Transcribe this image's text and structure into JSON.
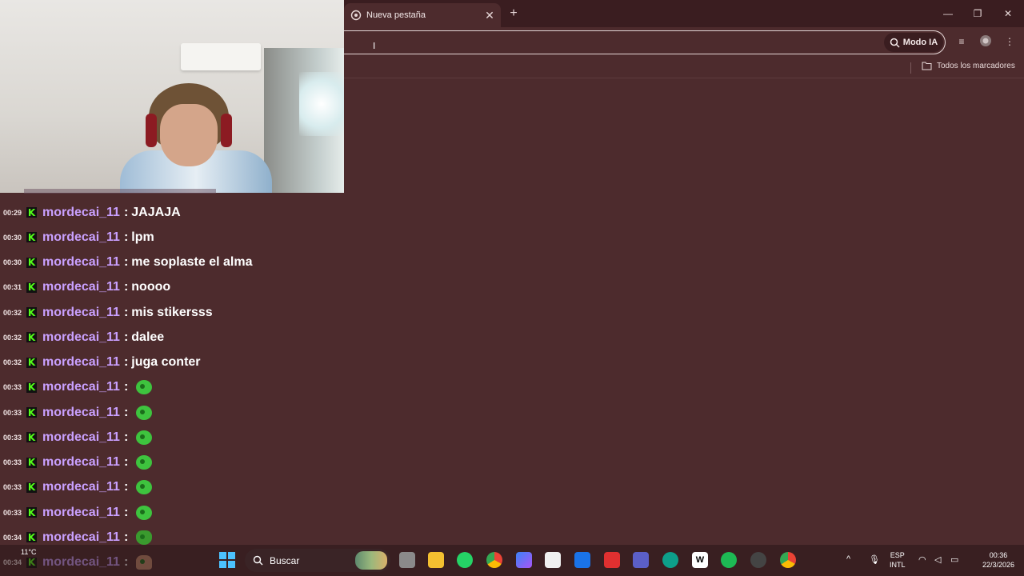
{
  "browser": {
    "tab_title": "Nueva pestaña",
    "tab_close": "✕",
    "new_tab": "+",
    "window_controls": [
      "—",
      "❐",
      "✕"
    ],
    "ai_mode_label": "Modo IA",
    "bookmarks_all": "Todos los marcadores"
  },
  "chat": {
    "username": "mordecai_11",
    "separator": ":",
    "messages": [
      {
        "time": "00:29",
        "text": "JAJAJA",
        "emote": ""
      },
      {
        "time": "00:30",
        "text": "lpm",
        "emote": ""
      },
      {
        "time": "00:30",
        "text": "me soplaste el alma",
        "emote": ""
      },
      {
        "time": "00:31",
        "text": "noooo",
        "emote": ""
      },
      {
        "time": "00:32",
        "text": "mis stikersss",
        "emote": ""
      },
      {
        "time": "00:32",
        "text": "dalee",
        "emote": ""
      },
      {
        "time": "00:32",
        "text": "juga conter",
        "emote": ""
      },
      {
        "time": "00:33",
        "text": "",
        "emote": "green-blob"
      },
      {
        "time": "00:33",
        "text": "",
        "emote": "green-blob"
      },
      {
        "time": "00:33",
        "text": "",
        "emote": "green-blob"
      },
      {
        "time": "00:33",
        "text": "",
        "emote": "green-blob"
      },
      {
        "time": "00:33",
        "text": "",
        "emote": "green-blob"
      },
      {
        "time": "00:33",
        "text": "",
        "emote": "green-blob"
      },
      {
        "time": "00:34",
        "text": "",
        "emote": "frog"
      },
      {
        "time": "00:34",
        "text": "",
        "emote": "man"
      }
    ]
  },
  "taskbar": {
    "weather_temp": "11°C",
    "search_label": "Buscar",
    "language_line1": "ESP",
    "language_line2": "INTL",
    "clock_time": "00:36",
    "clock_date": "22/3/2026"
  },
  "colors": {
    "page_bg": "#4d2b2d",
    "username": "#c9a0ff",
    "kick_green": "#53fc18"
  }
}
